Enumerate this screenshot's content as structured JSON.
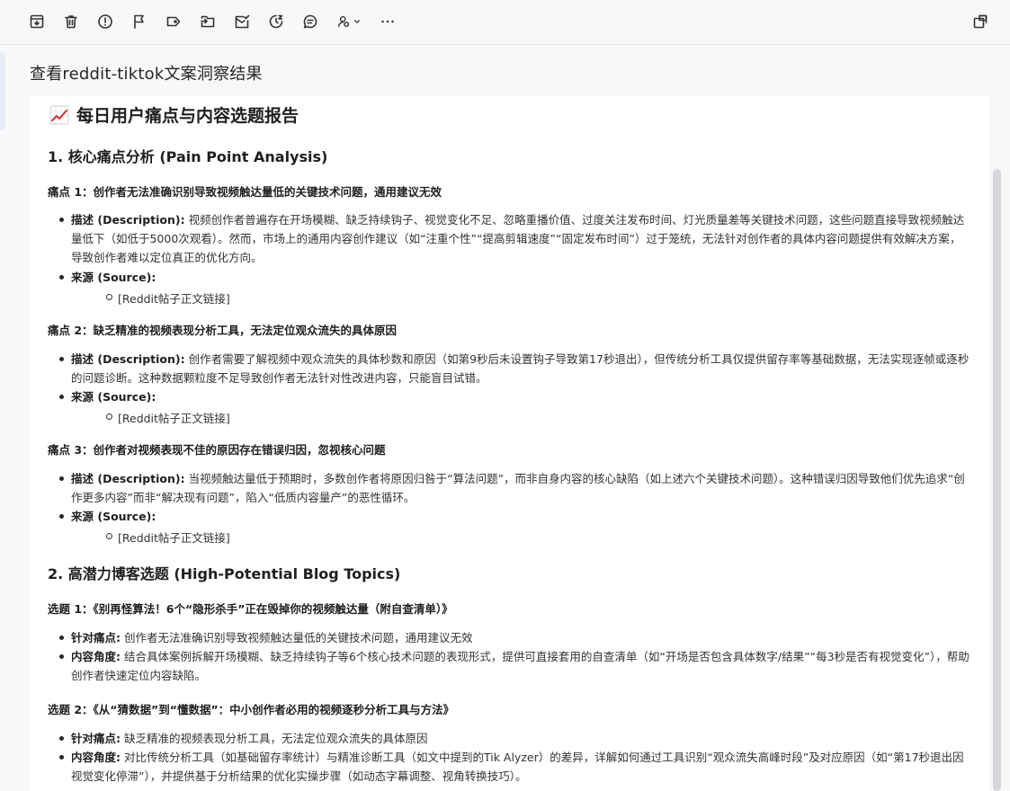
{
  "toolbar": {
    "icons": [
      "archive-icon",
      "trash-icon",
      "alert-icon",
      "flag-icon",
      "label-icon",
      "move-icon",
      "mark-read-icon",
      "snooze-icon",
      "chat-icon",
      "assign-icon",
      "more-icon",
      "popout-icon"
    ]
  },
  "email": {
    "subject": "查看reddit-tiktok文案洞察结果"
  },
  "report": {
    "title": "每日用户痛点与内容选题报告",
    "section1_title": "1. 核心痛点分析 (Pain Point Analysis)",
    "section2_title": "2. 高潜力博客选题 (High-Potential Blog Topics)",
    "pain1": {
      "title": "痛点 1：创作者无法准确识别导致视频触达量低的关键技术问题，通用建议无效",
      "desc_label": "描述 (Description):",
      "desc_text": " 视频创作者普遍存在开场模糊、缺乏持续钩子、视觉变化不足、忽略重播价值、过度关注发布时间、灯光质量差等关键技术问题，这些问题直接导致视频触达量低下（如低于5000次观看）。然而，市场上的通用内容创作建议（如“注重个性”“提高剪辑速度”“固定发布时间”）过于笼统，无法针对创作者的具体内容问题提供有效解决方案，导致创作者难以定位真正的优化方向。",
      "source_label": "来源 (Source):",
      "source_link": "[Reddit帖子正文链接]"
    },
    "pain2": {
      "title": "痛点 2：缺乏精准的视频表现分析工具，无法定位观众流失的具体原因",
      "desc_label": "描述 (Description):",
      "desc_text": " 创作者需要了解视频中观众流失的具体秒数和原因（如第9秒后未设置钩子导致第17秒退出），但传统分析工具仅提供留存率等基础数据，无法实现逐帧或逐秒的问题诊断。这种数据颗粒度不足导致创作者无法针对性改进内容，只能盲目试错。",
      "source_label": "来源 (Source):",
      "source_link": "[Reddit帖子正文链接]"
    },
    "pain3": {
      "title": "痛点 3：创作者对视频表现不佳的原因存在错误归因，忽视核心问题",
      "desc_label": "描述 (Description):",
      "desc_text": " 当视频触达量低于预期时，多数创作者将原因归咎于“算法问题”，而非自身内容的核心缺陷（如上述六个关键技术问题）。这种错误归因导致他们优先追求“创作更多内容”而非“解决现有问题”，陷入“低质内容量产”的恶性循环。",
      "source_label": "来源 (Source):",
      "source_link": "[Reddit帖子正文链接]"
    },
    "topic1": {
      "title": "选题 1：《别再怪算法！6个“隐形杀手”正在毁掉你的视频触达量（附自查清单）》",
      "target_label": "针对痛点:",
      "target_text": " 创作者无法准确识别导致视频触达量低的关键技术问题，通用建议无效",
      "angle_label": "内容角度:",
      "angle_text": " 结合具体案例拆解开场模糊、缺乏持续钩子等6个核心技术问题的表现形式，提供可直接套用的自查清单（如“开场是否包含具体数字/结果”“每3秒是否有视觉变化”），帮助创作者快速定位内容缺陷。"
    },
    "topic2": {
      "title": "选题 2：《从“猜数据”到“懂数据”：中小创作者必用的视频逐秒分析工具与方法》",
      "target_label": "针对痛点:",
      "target_text": " 缺乏精准的视频表现分析工具，无法定位观众流失的具体原因",
      "angle_label": "内容角度:",
      "angle_text": " 对比传统分析工具（如基础留存率统计）与精准诊断工具（如文中提到的Tik Alyzer）的差异，详解如何通过工具识别“观众流失高峰时段”及对应原因（如“第17秒退出因视觉变化停滞”），并提供基于分析结果的优化实操步骤（如动态字幕调整、视角转换技巧）。"
    }
  }
}
